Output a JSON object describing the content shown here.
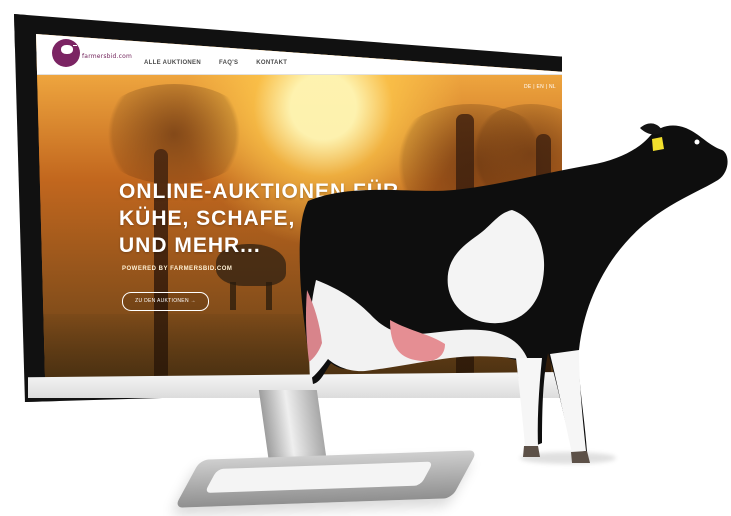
{
  "website": {
    "logo_text": "farmersbid.com",
    "nav": [
      {
        "label": "ALLE AUKTIONEN"
      },
      {
        "label": "FAQ'S"
      },
      {
        "label": "KONTAKT"
      }
    ],
    "language_switch": "DE | EN | NL",
    "hero": {
      "title": "ONLINE-AUKTIONEN FÜR KÜHE, SCHAFE, SCHWEINE UND MEHR...",
      "subtitle": "POWERED BY FARMERSBID.COM",
      "cta": "ZU DEN AUKTIONEN →"
    }
  },
  "colors": {
    "brand": "#7b2463",
    "hero_light": "#ffbd4b",
    "hero_dark": "#5b3d18",
    "monitor_frame": "#111111",
    "stand": "#d9d9d9"
  },
  "icons": {
    "logo": "cow-logo-icon"
  }
}
